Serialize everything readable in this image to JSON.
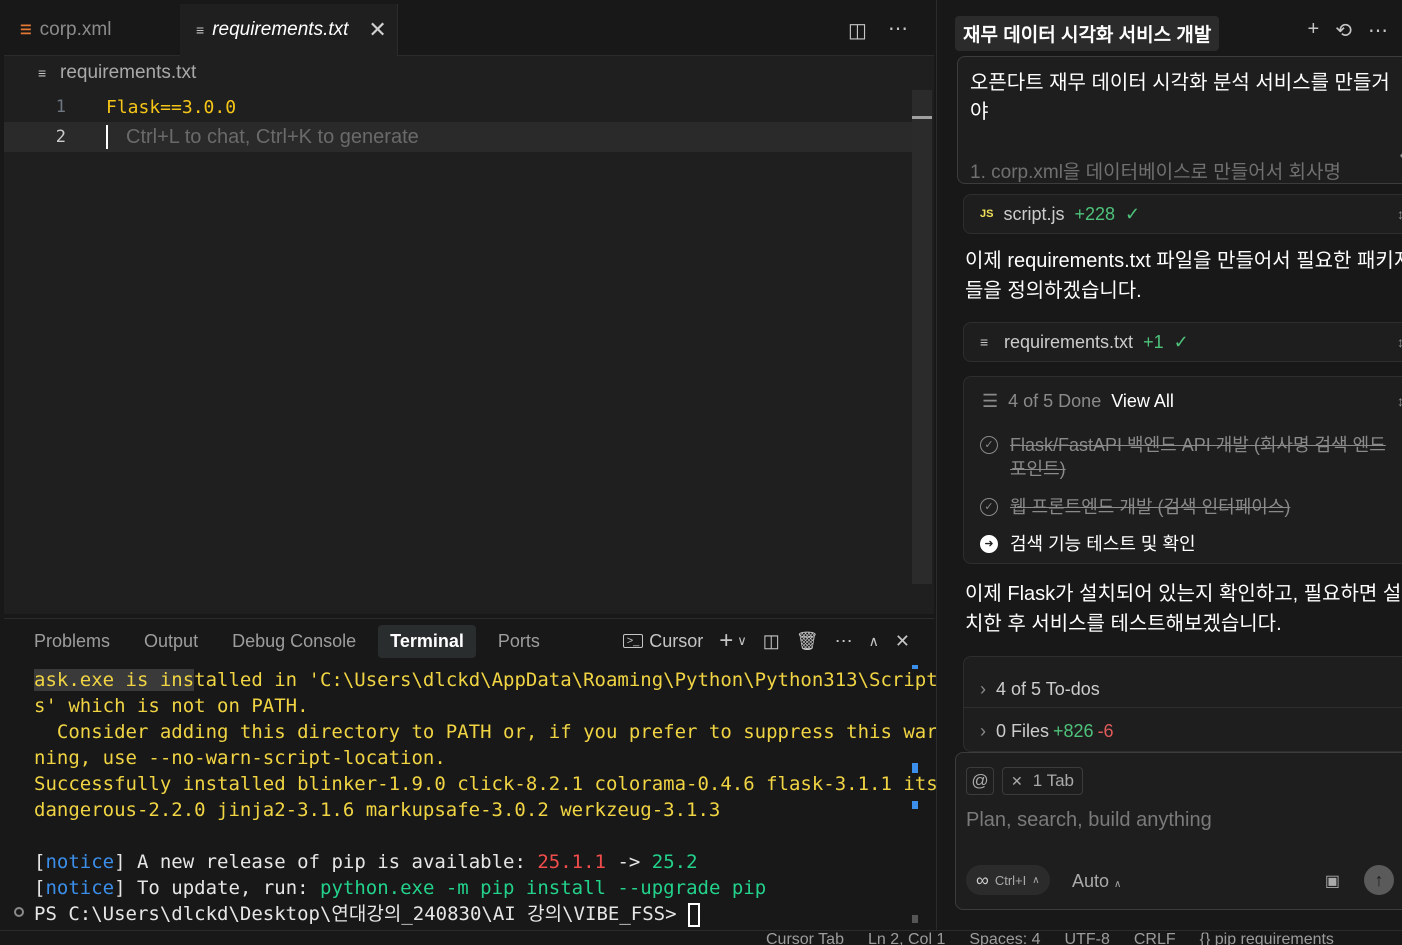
{
  "editor": {
    "tabs": [
      {
        "label": "corp.xml",
        "icon": "rss-icon"
      },
      {
        "label": "requirements.txt",
        "icon": "lines-icon"
      }
    ],
    "breadcrumb": "requirements.txt",
    "lines": [
      {
        "num": "1",
        "text": "Flask==3.0.0"
      },
      {
        "num": "2",
        "hint": "Ctrl+L to chat, Ctrl+K to generate"
      }
    ]
  },
  "panel": {
    "tabs": [
      "Problems",
      "Output",
      "Debug Console",
      "Terminal",
      "Ports"
    ],
    "active_tab": "Terminal",
    "terminal_profile": "Cursor",
    "terminal": {
      "l1a": "ask.exe is ins",
      "l1b": "talled in 'C:\\Users\\dlckd\\AppData\\Roaming\\Python\\Python313\\Script",
      "l2": "s' which is not on PATH.",
      "l3": "  Consider adding this directory to PATH or, if you prefer to suppress this war",
      "l4": "ning, use --no-warn-script-location.",
      "l5": "Successfully installed blinker-1.9.0 click-8.2.1 colorama-0.4.6 flask-3.1.1 its",
      "l6": "dangerous-2.2.0 jinja2-3.1.6 markupsafe-3.0.2 werkzeug-3.1.3",
      "notice": "notice",
      "n1_text": " A new release of pip is available: ",
      "n1_old": "25.1.1",
      "n1_arrow": " -> ",
      "n1_new": "25.2",
      "n2_text": " To update, run: ",
      "n2_cmd": "python.exe -m pip install --upgrade pip",
      "prompt": "PS C:\\Users\\dlckd\\Desktop\\연대강의_240830\\AI 강의\\VIBE_FSS> "
    }
  },
  "chat": {
    "title": "재무 데이터 시각화 서비스 개발",
    "user_message": "오픈다트 재무 데이터 시각화 분석 서비스를 만들거야",
    "user_message_faded": "1. corp.xml을 데이터베이스로 만들어서 회사명",
    "file1": {
      "name": "script.js",
      "diff": "+228",
      "check": "✓"
    },
    "para1": "이제 requirements.txt 파일을 만들어서 필요한 패키지들을 정의하겠습니다.",
    "file2": {
      "name": "requirements.txt",
      "diff": "+1",
      "check": "✓"
    },
    "todos": {
      "progress": "4 of 5 Done",
      "view_all": "View All",
      "items": [
        {
          "text": "Flask/FastAPI 백엔드 API 개발 (회사명 검색 엔드포인트)",
          "status": "done"
        },
        {
          "text": "웹 프론트엔드 개발 (검색 인터페이스)",
          "status": "done"
        },
        {
          "text": "검색 기능 테스트 및 확인",
          "status": "in-progress"
        }
      ]
    },
    "para2": "이제 Flask가 설치되어 있는지 확인하고, 필요하면 설치한 후 서비스를 테스트해보겠습니다.",
    "summary": {
      "todos": "4 of 5 To-dos",
      "files_label": "0 Files",
      "files_plus": "+826",
      "files_minus": "-6"
    },
    "composer": {
      "at": "@",
      "tab_chip": "1 Tab",
      "placeholder": "Plan, search, build anything",
      "mode": "Ctrl+I",
      "model": "Auto"
    }
  },
  "status": {
    "items": [
      "Cursor Tab",
      "Ln 2, Col 1",
      "Spaces: 4",
      "UTF-8",
      "CRLF",
      "{} pip requirements"
    ]
  }
}
